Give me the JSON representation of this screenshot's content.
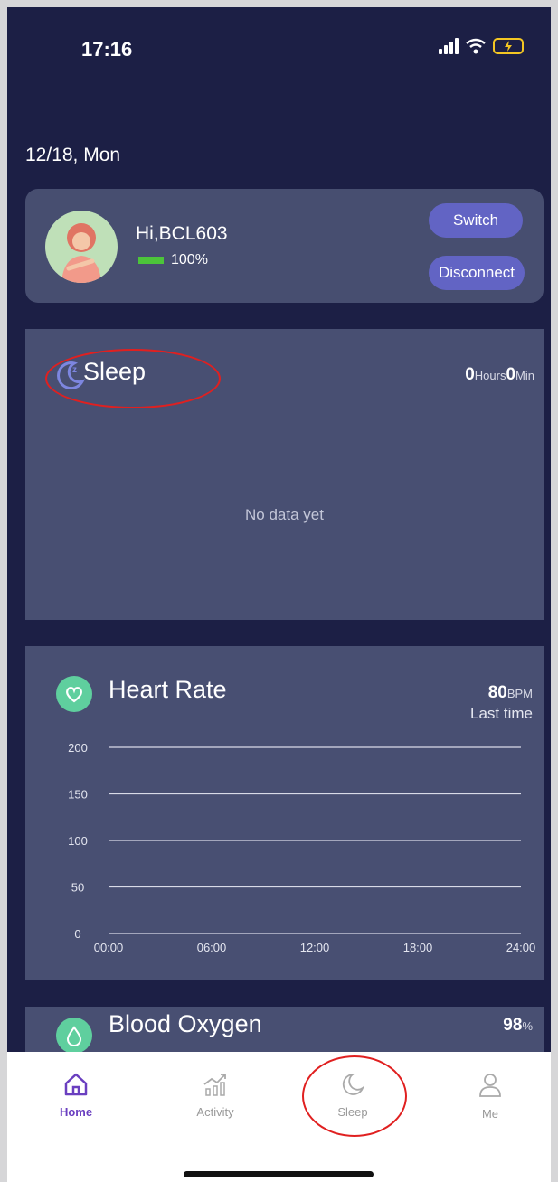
{
  "status_bar": {
    "time": "17:16"
  },
  "date": "12/18,  Mon",
  "device": {
    "greeting": "Hi,BCL603",
    "battery": "100%",
    "switch_label": "Switch",
    "disconnect_label": "Disconnect"
  },
  "sleep": {
    "title": "Sleep",
    "hours": "0",
    "hours_unit": "Hours",
    "mins": "0",
    "mins_unit": "Min",
    "empty": "No data yet"
  },
  "heart_rate": {
    "title": "Heart Rate",
    "value": "80",
    "unit": "BPM",
    "sub": "Last time"
  },
  "blood_oxygen": {
    "title": "Blood Oxygen",
    "value": "98",
    "unit": "%"
  },
  "tabs": [
    {
      "label": "Home",
      "icon": "home-icon",
      "active": true
    },
    {
      "label": "Activity",
      "icon": "activity-icon",
      "active": false
    },
    {
      "label": "Sleep",
      "icon": "moon-icon",
      "active": false
    },
    {
      "label": "Me",
      "icon": "user-icon",
      "active": false
    }
  ],
  "colors": {
    "background": "#1c1f45",
    "card": "#484f72",
    "accent": "#6264c4",
    "green": "#5fcf9e",
    "annotation": "#e02020"
  },
  "chart_data": {
    "type": "line",
    "x": [
      "00:00",
      "06:00",
      "12:00",
      "18:00",
      "24:00"
    ],
    "y_ticks": [
      200,
      150,
      100,
      50,
      0
    ],
    "ylim": [
      0,
      200
    ],
    "series": [],
    "grid": true
  }
}
